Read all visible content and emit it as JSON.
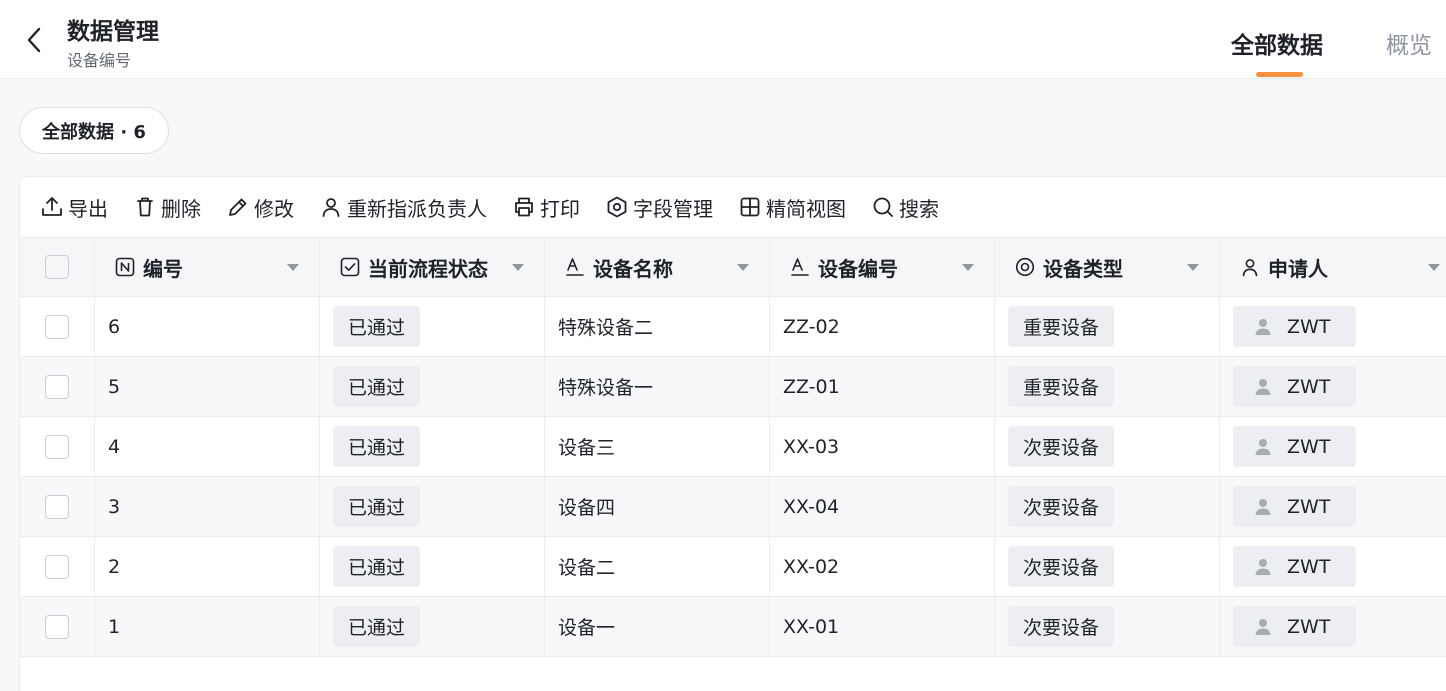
{
  "header": {
    "title": "数据管理",
    "subtitle": "设备编号",
    "tabs": [
      {
        "label": "全部数据",
        "active": true
      },
      {
        "label": "概览",
        "active": false
      }
    ],
    "accent": "#f7913b"
  },
  "view": {
    "label": "全部数据 · 6"
  },
  "toolbar": [
    {
      "icon": "export-icon",
      "label": "导出"
    },
    {
      "icon": "trash-icon",
      "label": "删除"
    },
    {
      "icon": "pencil-icon",
      "label": "修改"
    },
    {
      "icon": "user-icon",
      "label": "重新指派负责人"
    },
    {
      "icon": "printer-icon",
      "label": "打印"
    },
    {
      "icon": "settings-icon",
      "label": "字段管理"
    },
    {
      "icon": "grid-icon",
      "label": "精简视图"
    },
    {
      "icon": "search-icon",
      "label": "搜索"
    }
  ],
  "table": {
    "columns": [
      {
        "icon": "number-field-icon",
        "label": "编号"
      },
      {
        "icon": "checkbox-field-icon",
        "label": "当前流程状态"
      },
      {
        "icon": "text-field-icon",
        "label": "设备名称"
      },
      {
        "icon": "text-field-icon",
        "label": "设备编号"
      },
      {
        "icon": "radio-field-icon",
        "label": "设备类型"
      },
      {
        "icon": "user-field-icon",
        "label": "申请人"
      }
    ],
    "rows": [
      {
        "id": "6",
        "status": "已通过",
        "name": "特殊设备二",
        "code": "ZZ-02",
        "type": "重要设备",
        "applicant": "ZWT"
      },
      {
        "id": "5",
        "status": "已通过",
        "name": "特殊设备一",
        "code": "ZZ-01",
        "type": "重要设备",
        "applicant": "ZWT"
      },
      {
        "id": "4",
        "status": "已通过",
        "name": "设备三",
        "code": "XX-03",
        "type": "次要设备",
        "applicant": "ZWT"
      },
      {
        "id": "3",
        "status": "已通过",
        "name": "设备四",
        "code": "XX-04",
        "type": "次要设备",
        "applicant": "ZWT"
      },
      {
        "id": "2",
        "status": "已通过",
        "name": "设备二",
        "code": "XX-02",
        "type": "次要设备",
        "applicant": "ZWT"
      },
      {
        "id": "1",
        "status": "已通过",
        "name": "设备一",
        "code": "XX-01",
        "type": "次要设备",
        "applicant": "ZWT"
      }
    ]
  }
}
